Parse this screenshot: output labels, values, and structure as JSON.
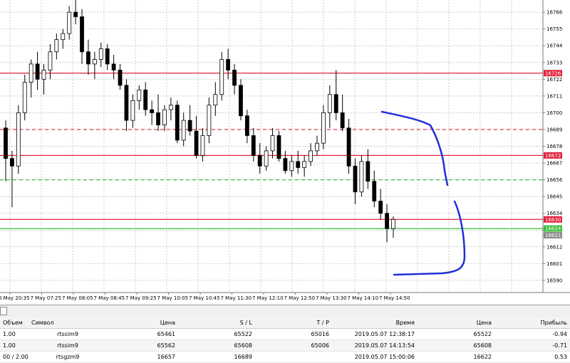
{
  "chart": {
    "y_axis": {
      "min": 16582,
      "max": 16774,
      "tick_labels": [
        "16766",
        "16755",
        "16744",
        "16733",
        "16722",
        "16711",
        "16700",
        "16689",
        "16678",
        "16667",
        "16656",
        "16645",
        "16634",
        "16623",
        "16612",
        "16601",
        "16590"
      ]
    },
    "x_axis": {
      "tick_labels": [
        "6 May 20:35",
        "7 May 07:25",
        "7 May 08:05",
        "7 May 08:45",
        "7 May 09:25",
        "7 May 10:05",
        "7 May 10:45",
        "7 May 11:30",
        "7 May 12:10",
        "7 May 12:50",
        "7 May 13:30",
        "7 May 14:10",
        "7 May 14:50"
      ]
    },
    "horizontal_lines": [
      {
        "level": 16726,
        "style": "solid",
        "color": "#e0243c",
        "tag": "16726"
      },
      {
        "level": 16689,
        "style": "dashed",
        "color": "#e0243c",
        "tag": ""
      },
      {
        "level": 16672,
        "style": "solid",
        "color": "#e0243c",
        "tag": "16672"
      },
      {
        "level": 16656,
        "style": "dashed",
        "color": "#3cbf3c",
        "tag": ""
      },
      {
        "level": 16630,
        "style": "solid",
        "color": "#e0243c",
        "tag": "16630"
      },
      {
        "level": 16624,
        "style": "solid",
        "color": "#3cbf3c",
        "tag": "16624"
      }
    ],
    "current_price_tag": "16621",
    "colors": {
      "grid": "#b8b8b8",
      "bull_fill": "#ffffff",
      "bear_fill": "#000000",
      "wick": "#000000",
      "annotation": "#1f2fd8",
      "red_tag": "#e0243c",
      "green_tag": "#3cbf3c",
      "grey_tag": "#8c8c8c"
    }
  },
  "chart_data": {
    "type": "candlestick",
    "y_range": [
      16582,
      16774
    ],
    "candles": [
      [
        16690,
        16695,
        16655,
        16670
      ],
      [
        16670,
        16675,
        16638,
        16665
      ],
      [
        16665,
        16705,
        16660,
        16700
      ],
      [
        16700,
        16725,
        16695,
        16720
      ],
      [
        16720,
        16735,
        16710,
        16732
      ],
      [
        16732,
        16740,
        16715,
        16722
      ],
      [
        16722,
        16732,
        16712,
        16728
      ],
      [
        16728,
        16745,
        16722,
        16740
      ],
      [
        16740,
        16752,
        16735,
        16748
      ],
      [
        16748,
        16755,
        16742,
        16752
      ],
      [
        16752,
        16770,
        16748,
        16766
      ],
      [
        16766,
        16774,
        16758,
        16763
      ],
      [
        16763,
        16768,
        16732,
        16740
      ],
      [
        16740,
        16748,
        16725,
        16732
      ],
      [
        16732,
        16740,
        16722,
        16735
      ],
      [
        16735,
        16746,
        16730,
        16742
      ],
      [
        16742,
        16745,
        16728,
        16732
      ],
      [
        16732,
        16738,
        16722,
        16728
      ],
      [
        16728,
        16732,
        16715,
        16718
      ],
      [
        16718,
        16722,
        16688,
        16695
      ],
      [
        16695,
        16712,
        16690,
        16708
      ],
      [
        16708,
        16718,
        16702,
        16715
      ],
      [
        16715,
        16720,
        16698,
        16702
      ],
      [
        16702,
        16708,
        16692,
        16700
      ],
      [
        16700,
        16712,
        16688,
        16692
      ],
      [
        16692,
        16705,
        16688,
        16702
      ],
      [
        16702,
        16710,
        16695,
        16705
      ],
      [
        16705,
        16708,
        16680,
        16682
      ],
      [
        16682,
        16700,
        16678,
        16695
      ],
      [
        16695,
        16705,
        16685,
        16688
      ],
      [
        16688,
        16698,
        16670,
        16672
      ],
      [
        16672,
        16690,
        16668,
        16685
      ],
      [
        16685,
        16710,
        16680,
        16705
      ],
      [
        16705,
        16720,
        16698,
        16712
      ],
      [
        16712,
        16740,
        16708,
        16735
      ],
      [
        16735,
        16742,
        16722,
        16728
      ],
      [
        16728,
        16732,
        16712,
        16718
      ],
      [
        16718,
        16722,
        16695,
        16698
      ],
      [
        16698,
        16702,
        16680,
        16685
      ],
      [
        16685,
        16690,
        16668,
        16672
      ],
      [
        16672,
        16680,
        16660,
        16665
      ],
      [
        16665,
        16678,
        16662,
        16675
      ],
      [
        16675,
        16690,
        16670,
        16685
      ],
      [
        16685,
        16688,
        16668,
        16670
      ],
      [
        16670,
        16675,
        16660,
        16662
      ],
      [
        16662,
        16672,
        16658,
        16668
      ],
      [
        16668,
        16675,
        16660,
        16664
      ],
      [
        16664,
        16672,
        16658,
        16668
      ],
      [
        16668,
        16680,
        16665,
        16675
      ],
      [
        16675,
        16685,
        16672,
        16680
      ],
      [
        16680,
        16705,
        16676,
        16700
      ],
      [
        16700,
        16718,
        16690,
        16712
      ],
      [
        16712,
        16728,
        16695,
        16700
      ],
      [
        16700,
        16712,
        16688,
        16690
      ],
      [
        16690,
        16696,
        16660,
        16665
      ],
      [
        16665,
        16670,
        16640,
        16648
      ],
      [
        16648,
        16672,
        16645,
        16668
      ],
      [
        16668,
        16676,
        16650,
        16655
      ],
      [
        16655,
        16662,
        16638,
        16642
      ],
      [
        16642,
        16650,
        16630,
        16634
      ],
      [
        16634,
        16640,
        16615,
        16624
      ],
      [
        16624,
        16632,
        16618,
        16630
      ]
    ]
  },
  "positions_table": {
    "headers": [
      "Объем",
      "Символ",
      "Цена",
      "S / L",
      "T / P",
      "Время",
      "Цена",
      "Прибыль"
    ],
    "rows": [
      {
        "volume": "1.00",
        "symbol": "rtssim9",
        "price": "65461",
        "sl": "65522",
        "tp": "65016",
        "time": "2019.05.07 12:38:17",
        "current": "65522",
        "profit": "-0.94"
      },
      {
        "volume": "1.00",
        "symbol": "rtssim9",
        "price": "65562",
        "sl": "65608",
        "tp": "65006",
        "time": "2019.05.07 14:13:54",
        "current": "65608",
        "profit": "-0.71"
      },
      {
        "volume": "00 / 2.00",
        "symbol": "rtsgzm9",
        "price": "16657",
        "sl": "16689",
        "tp": "",
        "time": "2019.05.07 15:00:06",
        "current": "16622",
        "profit": "0.53"
      }
    ]
  }
}
